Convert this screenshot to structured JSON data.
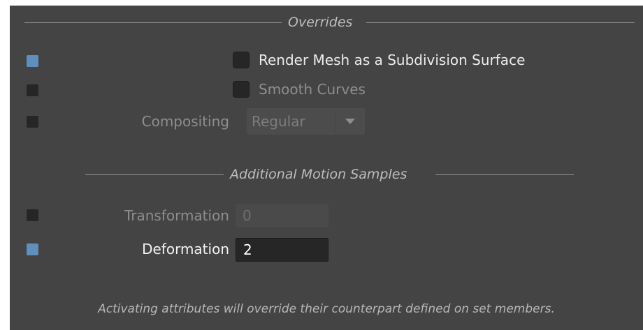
{
  "overrides": {
    "title": "Overrides",
    "render_mesh_subdiv": {
      "label": "Render Mesh as a Subdivision Surface",
      "override_active": true,
      "checked": false
    },
    "smooth_curves": {
      "label": "Smooth Curves",
      "override_active": false,
      "checked": false
    },
    "compositing": {
      "label": "Compositing",
      "value": "Regular",
      "override_active": false
    }
  },
  "motion_samples": {
    "title": "Additional Motion Samples",
    "transformation": {
      "label": "Transformation",
      "value": "0",
      "override_active": false
    },
    "deformation": {
      "label": "Deformation",
      "value": "2",
      "override_active": true
    }
  },
  "footer": {
    "text": "Activating attributes will override their counterpart defined on set members."
  },
  "colors": {
    "panel_bg": "#444444",
    "indicator_active": "#5f8fbc",
    "indicator_inactive": "#262626"
  },
  "icons": {
    "dropdown": "chevron-down-icon"
  }
}
